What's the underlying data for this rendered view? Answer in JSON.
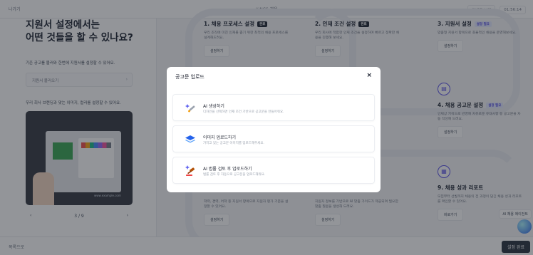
{
  "topbar": {
    "exit_label": "나가기",
    "title": "// NCS 채용",
    "right_chip_1": "안내도 보기",
    "right_chip_2": "01:56:14"
  },
  "left": {
    "heading": "지원서 설정에서는\n어떤 것들을 할 수 있나요?",
    "load_desc": "기존 공고를 불러와 한번에 지원서를 설정할 수 있어요.",
    "load_placeholder": "지원서 불러오기",
    "brand_desc": "우리 회사 브랜딩과 맞는 이미지, 컬러를 설정할 수 있어요.",
    "preview_caption": "www.example.com",
    "pager": {
      "prev": "‹",
      "count": "3 / 9",
      "next": "›"
    }
  },
  "steps": [
    {
      "title": "1. 채용 프로세스 설정",
      "badge": "완료",
      "desc": "우리 조직에 미친 인재를 뽑기 위한 최적의 채용 프로세스를 설계해드려요.",
      "button": "설정하기"
    },
    {
      "title": "2. 인재 조건 설정",
      "badge": "완료",
      "desc": "우리 회사에 적합한 인재 조건을 설정하여 빠르고 정확한 채용을 진행해 보세요.",
      "button": "설정하기"
    },
    {
      "title": "3. 지원서 설정",
      "badge": "설정 필요",
      "desc": "맞춤형 지원서 항목으로 효율적인 채용을 운영해보세요.",
      "button": "설정하기"
    },
    {
      "title": "4. 채용 공고문 설정",
      "badge": "설정 필요",
      "desc": "인재상 키워드로 반영해 자유로운 유대사항 등 공고문을 자동 작성해 드려요.",
      "button": "설정하기"
    },
    {
      "title": "",
      "badge": "",
      "desc": "학력, 경력, 어학 등 지원서 항목으로 지원자 평가 기준을 설정할 수 있어요.",
      "button": "설정하기"
    },
    {
      "title": "",
      "badge": "",
      "desc": "지원자 정보를 기반으로 AI 맞춤 가이드가 제공되며 필요한 맞춤 질문을 생성해 드려요.",
      "button": "설정하기"
    },
    {
      "title": "9. 채용 성과 리포트",
      "badge": "",
      "desc": "모집부터 선발까지 채용의 전 과정이 담긴 채용 성과 리포트를 확인할 수 있어요.",
      "button": "바로가기"
    }
  ],
  "bottombar": {
    "back_label": "목록으로",
    "done_label": "설정 완료"
  },
  "help": {
    "label": "AI 채용 에이전트"
  },
  "modal": {
    "title": "공고문 업로드",
    "close": "×",
    "options": [
      {
        "title": "AI 생성하기",
        "desc": "디자인을 선택하면 인재 조건 기반으로 공고문을 만들어줘요.",
        "icon": "ai-sparkle-pen-icon"
      },
      {
        "title": "이미지 업로드하기",
        "desc": "가지고 있는 공고문 이미지를 업로드해주세요.",
        "icon": "layers-stack-icon"
      },
      {
        "title": "AI 법률 검토 후 업로드하기",
        "desc": "법률 검토 후 자동으로 공고문을 업로드해줘요.",
        "icon": "ai-gavel-icon"
      }
    ]
  },
  "colors": {
    "accent": "#4f46e5",
    "ink": "#111827",
    "overlay": "rgba(40,44,52,0.5)"
  }
}
